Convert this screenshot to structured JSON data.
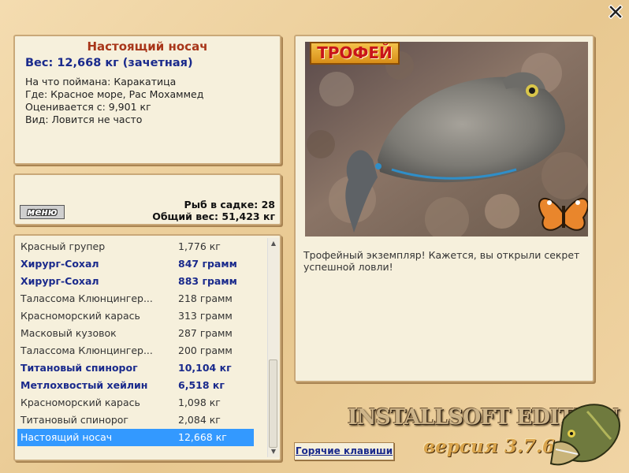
{
  "icons": {
    "close": "close-icon",
    "trophy": "trophy-icon",
    "pike": "pike-logo"
  },
  "fish": {
    "title": "Настоящий носач",
    "weight": "Вес: 12,668 кг (зачетная)",
    "lines": [
      "На что поймана: Каракатица",
      "Где: Красное море, Рас Мохаммед",
      "Оценивается с: 9,901 кг",
      "Вид: Ловится не часто"
    ]
  },
  "stats": {
    "menu_label": "меню",
    "cage_count": "Рыб в садке: 28",
    "total_weight": "Общий вес: 51,423 кг"
  },
  "catch_list": {
    "rows": [
      {
        "name": "Красный групер",
        "weight": "1,776 кг",
        "style": "plain"
      },
      {
        "name": "Хирург-Сохал",
        "weight": "847 грамм",
        "style": "bold"
      },
      {
        "name": "Хирург-Сохал",
        "weight": "883 грамм",
        "style": "bold"
      },
      {
        "name": "Талассома Клюнцингер...",
        "weight": "218 грамм",
        "style": "plain"
      },
      {
        "name": "Красноморский карась",
        "weight": "313 грамм",
        "style": "plain"
      },
      {
        "name": "Масковый кузовок",
        "weight": "287 грамм",
        "style": "plain"
      },
      {
        "name": "Талассома Клюнцингер...",
        "weight": "200 грамм",
        "style": "plain"
      },
      {
        "name": "Титановый спинорог",
        "weight": "10,104 кг",
        "style": "bold"
      },
      {
        "name": "Метлохвостый хейлин",
        "weight": "6,518 кг",
        "style": "bold"
      },
      {
        "name": "Красноморский карась",
        "weight": "1,098 кг",
        "style": "plain"
      },
      {
        "name": "Титановый спинорог",
        "weight": "2,084 кг",
        "style": "plain"
      },
      {
        "name": "Настоящий носач",
        "weight": "12,668 кг",
        "style": "sel"
      }
    ]
  },
  "photo": {
    "badge": "ТРОФЕЙ",
    "description": "Трофейный экземпляр! Кажется, вы открыли секрет успешной ловли!"
  },
  "footer": {
    "hotkeys_label": "Горячие клавиши",
    "brand": "INSTALLSOFT EDITION",
    "version": "версия 3.7.6"
  },
  "colors": {
    "accent_title": "#a8361a",
    "accent_blue": "#1a2a8c",
    "selection": "#3399ff",
    "panel_bg": "#f6f0dc",
    "page_bg": "#e8c890"
  }
}
